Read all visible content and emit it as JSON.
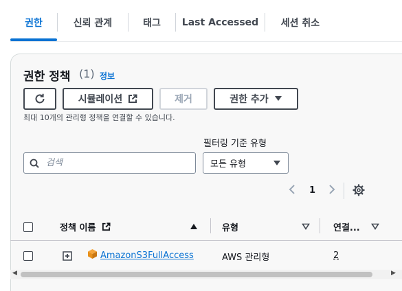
{
  "tabs": [
    {
      "label": "권한",
      "active": true
    },
    {
      "label": "신뢰 관계",
      "active": false
    },
    {
      "label": "태그",
      "active": false
    },
    {
      "label": "Last Accessed",
      "active": false
    },
    {
      "label": "세션 취소",
      "active": false
    }
  ],
  "section": {
    "title": "권한 정책",
    "count": "(1)",
    "info_link": "정보"
  },
  "toolbar": {
    "refresh_icon": "refresh-icon",
    "simulate_label": "시뮬레이션",
    "remove_label": "제거",
    "add_label": "권한 추가"
  },
  "hint": "최대 10개의 관리형 정책을 연결할 수 있습니다.",
  "filter": {
    "label": "필터링 기준 유형",
    "search_placeholder": "검색",
    "select_value": "모든 유형"
  },
  "pagination": {
    "current_page": "1"
  },
  "table": {
    "columns": [
      {
        "label": "정책 이름",
        "sort": "ascending"
      },
      {
        "label": "유형",
        "sort": "none"
      },
      {
        "label": "연결...",
        "sort": "none"
      }
    ],
    "rows": [
      {
        "name": "AmazonS3FullAccess",
        "type": "AWS 관리형",
        "attached": "2"
      }
    ]
  },
  "colors": {
    "accent": "#0972d3",
    "text": "#16191f",
    "disabled": "#9ba7b6",
    "s3_icon": "#e8901a"
  }
}
